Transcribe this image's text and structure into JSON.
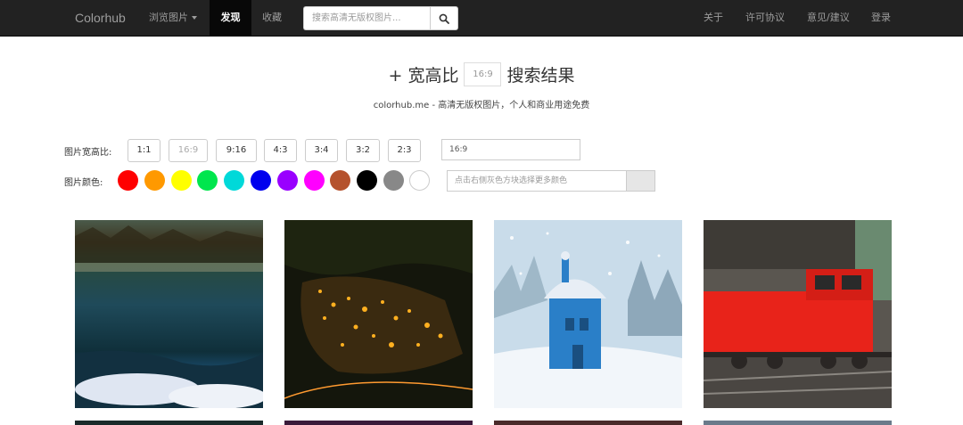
{
  "navbar": {
    "brand": "Colorhub",
    "browse": "浏览图片",
    "discover": "发现",
    "favorites": "收藏",
    "search_placeholder": "搜索高清无版权图片...",
    "about": "关于",
    "license": "许可协议",
    "feedback": "意见/建议",
    "login": "登录"
  },
  "heading": {
    "prefix": "+ 宽高比",
    "ratio": "16:9",
    "suffix": "搜索结果",
    "subtitle": "colorhub.me - 高清无版权图片，个人和商业用途免费"
  },
  "filters": {
    "ratio_label": "图片宽高比:",
    "ratios": [
      "1:1",
      "16:9",
      "9:16",
      "4:3",
      "3:4",
      "3:2",
      "2:3"
    ],
    "active_ratio": "16:9",
    "ratio_value": "16:9",
    "color_label": "图片颜色:",
    "colors": [
      "#ff0000",
      "#ff9900",
      "#ffff00",
      "#00e64d",
      "#00d9d9",
      "#0000ee",
      "#9900ff",
      "#ff00ff",
      "#b5522d",
      "#000000",
      "#888888",
      "#ffffff"
    ],
    "color_placeholder": "点击右侧灰色方块选择更多颜色"
  },
  "accent": {
    "navbar_bg": "#222222",
    "active_bg": "#080808"
  }
}
